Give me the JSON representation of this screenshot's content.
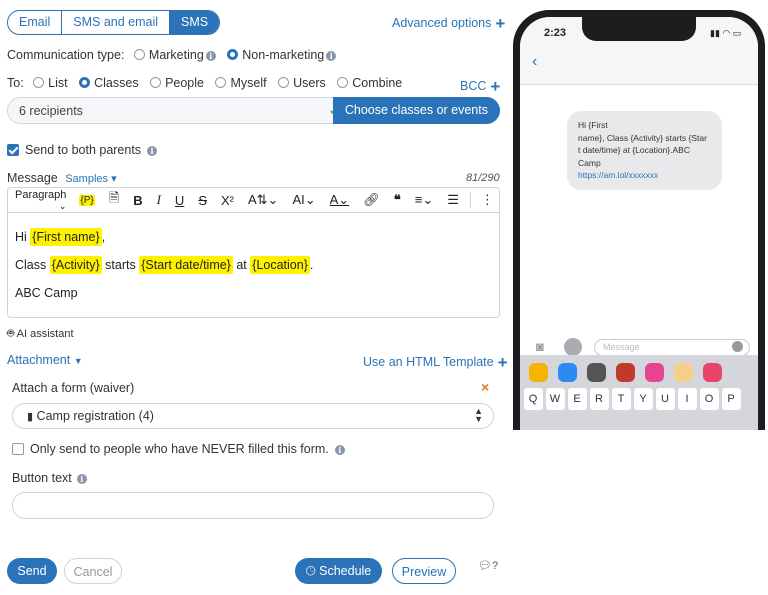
{
  "tabs": [
    "Email",
    "SMS and email",
    "SMS"
  ],
  "advanced_options": "Advanced options",
  "comm_type": {
    "label": "Communication type:",
    "options": [
      "Marketing",
      "Non-marketing"
    ]
  },
  "to": {
    "label": "To:",
    "options": [
      "List",
      "Classes",
      "People",
      "Myself",
      "Users",
      "Combine"
    ],
    "bcc": "BCC"
  },
  "recipients": {
    "value": "6 recipients",
    "button": "Choose classes or events"
  },
  "send_both_parents": "Send to both parents",
  "message": {
    "label": "Message",
    "samples": "Samples",
    "counter": "81/290"
  },
  "toolbar": {
    "paragraph": "Paragraph",
    "placeholder_tag": "{P}"
  },
  "body": {
    "line1_pre": "Hi",
    "first_name": "{First name}",
    "line1_post": ",",
    "line2_pre": "Class",
    "activity": "{Activity}",
    "starts": "starts",
    "start_date": "{Start date/time}",
    "at": "at",
    "location": "{Location}",
    "line2_post": ".",
    "line3": "ABC Camp"
  },
  "ai_assistant": "AI assistant",
  "attachment": "Attachment",
  "html_template": "Use an HTML Template",
  "attach_form": "Attach a form (waiver)",
  "form_select": "Camp registration (4)",
  "never_filled": "Only send to people who have NEVER filled this form.",
  "button_text_label": "Button text",
  "button_text_value": "",
  "buttons": {
    "send": "Send",
    "cancel": "Cancel",
    "schedule": "Schedule",
    "preview": "Preview",
    "help": "?"
  },
  "phone": {
    "time": "2:23",
    "sms_lines": [
      "Hi {First",
      "name}, Class {Activity} starts {Star",
      "t date/time} at {Location}.ABC",
      "Camp"
    ],
    "sms_link": "https://am.lol/xxxxxxx",
    "message_placeholder": "Message",
    "keys": [
      "Q",
      "W",
      "E",
      "R",
      "T",
      "Y",
      "U",
      "I",
      "O",
      "P"
    ],
    "app_colors": [
      "#f4b400",
      "#2a8cf0",
      "#555555",
      "#c0392b",
      "#e84393",
      "#f5d08a",
      "#e8456a"
    ]
  },
  "colors": {
    "accent": "#2a73b8",
    "highlight": "#fff200",
    "success": "#3cb371",
    "danger": "#e67e22"
  }
}
